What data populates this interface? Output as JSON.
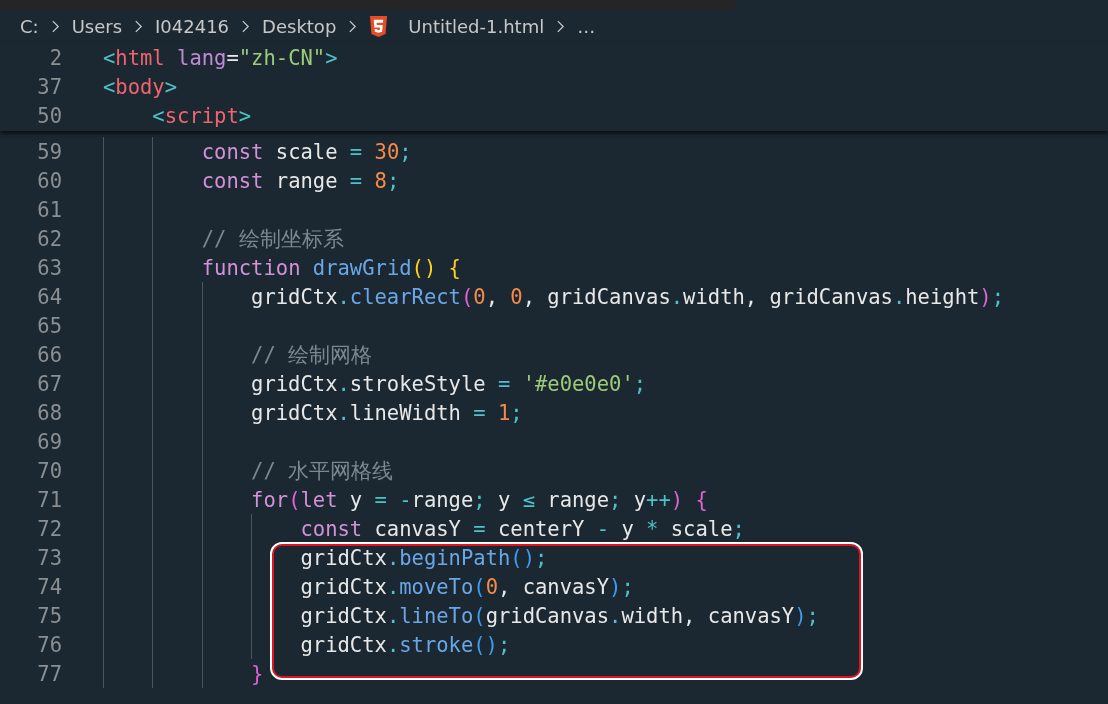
{
  "breadcrumb": [
    {
      "label": "C:",
      "kind": "folder"
    },
    {
      "label": "Users",
      "kind": "folder"
    },
    {
      "label": "I042416",
      "kind": "folder"
    },
    {
      "label": "Desktop",
      "kind": "folder"
    },
    {
      "label": "Untitled-1.html",
      "kind": "html-file"
    },
    {
      "label": "…",
      "kind": "more"
    }
  ],
  "sticky_lines": [
    {
      "number": "2",
      "tokens": [
        {
          "t": "<",
          "kind": "angle"
        },
        {
          "t": "html ",
          "kind": "tag"
        },
        {
          "t": "lang",
          "kind": "attr"
        },
        {
          "t": "=",
          "kind": "plain"
        },
        {
          "t": "\"zh-CN\"",
          "kind": "str"
        },
        {
          "t": ">",
          "kind": "angle"
        }
      ]
    },
    {
      "number": "37",
      "tokens": [
        {
          "t": "<",
          "kind": "angle"
        },
        {
          "t": "body",
          "kind": "tag"
        },
        {
          "t": ">",
          "kind": "angle"
        }
      ],
      "children": [
        {
          "number": "50",
          "tokens": [
            {
              "t": "<",
              "kind": "angle"
            },
            {
              "t": "script",
              "kind": "tag"
            },
            {
              "t": ">",
              "kind": "angle"
            }
          ]
        }
      ]
    }
  ],
  "code_lines": [
    {
      "number": "59",
      "tokens": [
        {
          "t": "const",
          "kind": "kw"
        },
        {
          "t": " scale ",
          "kind": "plain"
        },
        {
          "t": "= ",
          "kind": "punct"
        },
        {
          "t": "30",
          "kind": "num"
        },
        {
          "t": ";",
          "kind": "punct"
        }
      ]
    },
    {
      "number": "60",
      "tokens": [
        {
          "t": "const",
          "kind": "kw"
        },
        {
          "t": " range ",
          "kind": "plain"
        },
        {
          "t": "= ",
          "kind": "punct"
        },
        {
          "t": "8",
          "kind": "num"
        },
        {
          "t": ";",
          "kind": "punct"
        }
      ]
    },
    {
      "number": "61"
    },
    {
      "number": "62",
      "tokens": [
        {
          "t": "// 绘制坐标系",
          "kind": "cmt"
        }
      ]
    },
    {
      "number": "63",
      "tokens": [
        {
          "t": "function ",
          "kind": "kw"
        },
        {
          "t": "drawGrid",
          "kind": "fn"
        },
        {
          "t": "() {",
          "kind": "paren1"
        }
      ],
      "children": [
        {
          "number": "64",
          "tokens": [
            {
              "t": "gridCtx",
              "kind": "plain"
            },
            {
              "t": ".",
              "kind": "punct"
            },
            {
              "t": "clearRect",
              "kind": "fn"
            },
            {
              "t": "(",
              "kind": "paren2"
            },
            {
              "t": "0",
              "kind": "num"
            },
            {
              "t": ", ",
              "kind": "plain"
            },
            {
              "t": "0",
              "kind": "num"
            },
            {
              "t": ", gridCanvas",
              "kind": "plain"
            },
            {
              "t": ".",
              "kind": "punct"
            },
            {
              "t": "width, gridCanvas",
              "kind": "plain"
            },
            {
              "t": ".",
              "kind": "punct"
            },
            {
              "t": "height",
              "kind": "plain"
            },
            {
              "t": ")",
              "kind": "paren2"
            },
            {
              "t": ";",
              "kind": "punct"
            }
          ]
        },
        {
          "number": "65"
        },
        {
          "number": "66",
          "tokens": [
            {
              "t": "// 绘制网格",
              "kind": "cmt"
            }
          ]
        },
        {
          "number": "67",
          "tokens": [
            {
              "t": "gridCtx",
              "kind": "plain"
            },
            {
              "t": ".",
              "kind": "punct"
            },
            {
              "t": "strokeStyle ",
              "kind": "plain"
            },
            {
              "t": "= ",
              "kind": "punct"
            },
            {
              "t": "'#e0e0e0'",
              "kind": "str"
            },
            {
              "t": ";",
              "kind": "punct"
            }
          ]
        },
        {
          "number": "68",
          "tokens": [
            {
              "t": "gridCtx",
              "kind": "plain"
            },
            {
              "t": ".",
              "kind": "punct"
            },
            {
              "t": "lineWidth ",
              "kind": "plain"
            },
            {
              "t": "= ",
              "kind": "punct"
            },
            {
              "t": "1",
              "kind": "num"
            },
            {
              "t": ";",
              "kind": "punct"
            }
          ]
        },
        {
          "number": "69"
        },
        {
          "number": "70",
          "tokens": [
            {
              "t": "// 水平网格线",
              "kind": "cmt"
            }
          ]
        },
        {
          "number": "71",
          "tokens": [
            {
              "t": "for",
              "kind": "kw"
            },
            {
              "t": "(",
              "kind": "paren2"
            },
            {
              "t": "let",
              "kind": "kw"
            },
            {
              "t": " y ",
              "kind": "plain"
            },
            {
              "t": "= -",
              "kind": "punct"
            },
            {
              "t": "range",
              "kind": "plain"
            },
            {
              "t": ";",
              "kind": "punct"
            },
            {
              "t": " y ",
              "kind": "plain"
            },
            {
              "t": "≤",
              "kind": "punct"
            },
            {
              "t": " range",
              "kind": "plain"
            },
            {
              "t": ";",
              "kind": "punct"
            },
            {
              "t": " y",
              "kind": "plain"
            },
            {
              "t": "++",
              "kind": "punct"
            },
            {
              "t": ") {",
              "kind": "paren2"
            }
          ],
          "children": [
            {
              "number": "72",
              "tokens": [
                {
                  "t": "const",
                  "kind": "kw"
                },
                {
                  "t": " canvasY ",
                  "kind": "plain"
                },
                {
                  "t": "=",
                  "kind": "punct"
                },
                {
                  "t": " centerY ",
                  "kind": "plain"
                },
                {
                  "t": "-",
                  "kind": "punct"
                },
                {
                  "t": " y ",
                  "kind": "plain"
                },
                {
                  "t": "*",
                  "kind": "punct"
                },
                {
                  "t": " scale",
                  "kind": "plain"
                },
                {
                  "t": ";",
                  "kind": "punct"
                }
              ]
            },
            {
              "number": "73",
              "highlighted": true,
              "tokens": [
                {
                  "t": "gridCtx",
                  "kind": "plain"
                },
                {
                  "t": ".",
                  "kind": "punct"
                },
                {
                  "t": "beginPath",
                  "kind": "fn"
                },
                {
                  "t": "()",
                  "kind": "paren3"
                },
                {
                  "t": ";",
                  "kind": "punct"
                }
              ]
            },
            {
              "number": "74",
              "highlighted": true,
              "tokens": [
                {
                  "t": "gridCtx",
                  "kind": "plain"
                },
                {
                  "t": ".",
                  "kind": "punct"
                },
                {
                  "t": "moveTo",
                  "kind": "fn"
                },
                {
                  "t": "(",
                  "kind": "paren3"
                },
                {
                  "t": "0",
                  "kind": "num"
                },
                {
                  "t": ", canvasY",
                  "kind": "plain"
                },
                {
                  "t": ")",
                  "kind": "paren3"
                },
                {
                  "t": ";",
                  "kind": "punct"
                }
              ]
            },
            {
              "number": "75",
              "highlighted": true,
              "tokens": [
                {
                  "t": "gridCtx",
                  "kind": "plain"
                },
                {
                  "t": ".",
                  "kind": "punct"
                },
                {
                  "t": "lineTo",
                  "kind": "fn"
                },
                {
                  "t": "(",
                  "kind": "paren3"
                },
                {
                  "t": "gridCanvas",
                  "kind": "plain"
                },
                {
                  "t": ".",
                  "kind": "punct"
                },
                {
                  "t": "width, canvasY",
                  "kind": "plain"
                },
                {
                  "t": ")",
                  "kind": "paren3"
                },
                {
                  "t": ";",
                  "kind": "punct"
                }
              ]
            },
            {
              "number": "76",
              "highlighted": true,
              "tokens": [
                {
                  "t": "gridCtx",
                  "kind": "plain"
                },
                {
                  "t": ".",
                  "kind": "punct"
                },
                {
                  "t": "stroke",
                  "kind": "fn"
                },
                {
                  "t": "()",
                  "kind": "paren3"
                },
                {
                  "t": ";",
                  "kind": "punct"
                }
              ]
            }
          ]
        },
        {
          "number": "77",
          "tokens": [
            {
              "t": "}",
              "kind": "paren2"
            }
          ]
        }
      ]
    }
  ]
}
